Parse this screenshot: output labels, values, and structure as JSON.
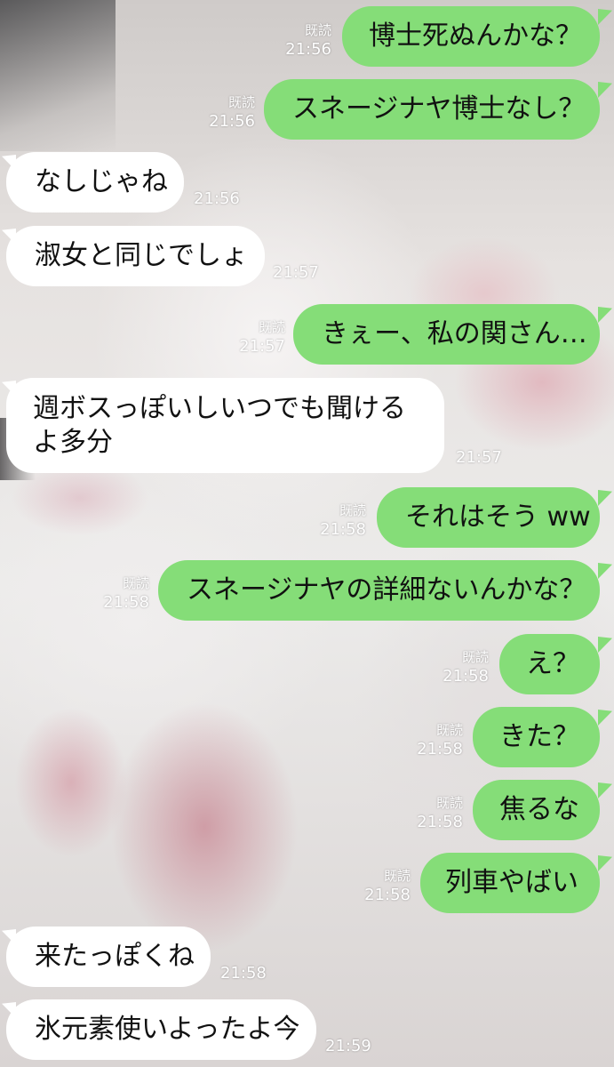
{
  "messages": [
    {
      "side": "me",
      "text": "博士死ぬんかな？",
      "read": "既読",
      "time": "21:56"
    },
    {
      "side": "me",
      "text": "スネージナヤ博士なし？",
      "read": "既読",
      "time": "21:56"
    },
    {
      "side": "them",
      "text": "なしじゃね",
      "time": "21:56"
    },
    {
      "side": "them",
      "text": "淑女と同じでしょ",
      "time": "21:57"
    },
    {
      "side": "me",
      "text": "きぇー、私の関さん…",
      "read": "既読",
      "time": "21:57"
    },
    {
      "side": "them",
      "text": "週ボスっぽいしいつでも聞けるよ多分",
      "time": "21:57"
    },
    {
      "side": "me",
      "text": "それはそう ww",
      "read": "既読",
      "time": "21:58"
    },
    {
      "side": "me",
      "text": "スネージナヤの詳細ないんかな？",
      "read": "既読",
      "time": "21:58"
    },
    {
      "side": "me",
      "text": "え？",
      "read": "既読",
      "time": "21:58"
    },
    {
      "side": "me",
      "text": "きた？",
      "read": "既読",
      "time": "21:58"
    },
    {
      "side": "me",
      "text": "焦るな",
      "read": "既読",
      "time": "21:58"
    },
    {
      "side": "me",
      "text": "列車やばい",
      "read": "既読",
      "time": "21:58"
    },
    {
      "side": "them",
      "text": "来たっぽくね",
      "time": "21:58"
    },
    {
      "side": "them",
      "text": "氷元素使いよったよ今",
      "time": "21:59"
    }
  ],
  "colors": {
    "my_bubble": "#85dd78",
    "their_bubble": "#ffffff",
    "meta_text": "#ffffff"
  }
}
